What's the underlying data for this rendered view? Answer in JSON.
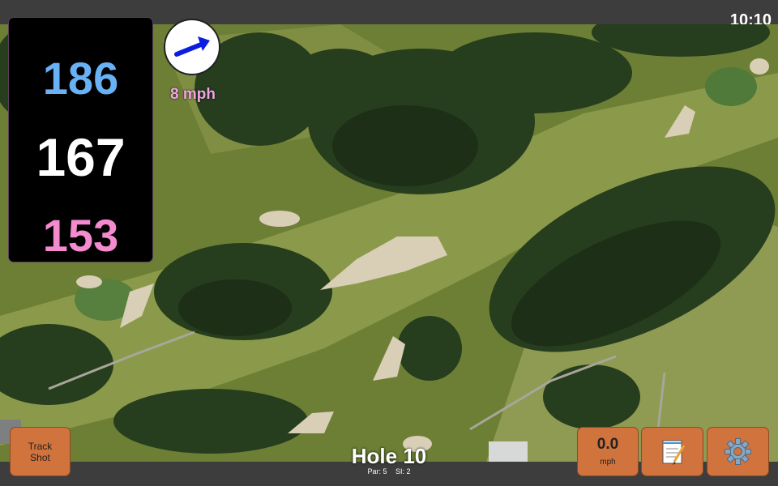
{
  "status_bar": {
    "time": "10:10"
  },
  "distances": {
    "back": "186",
    "middle": "167",
    "front": "153"
  },
  "wind": {
    "speed": "8 mph",
    "direction_icon": "arrow-right-icon",
    "color": "#0a1de0"
  },
  "hole": {
    "title": "Hole 10",
    "par": "Par: 5",
    "si": "SI: 2"
  },
  "buttons": {
    "track_shot": [
      "Track",
      "Shot"
    ],
    "wind_speed_value": "0.0",
    "wind_speed_unit": "mph",
    "notes_icon": "notepad-icon",
    "settings_icon": "gear-icon"
  },
  "colors": {
    "back": "#68b1f5",
    "middle": "#ffffff",
    "front": "#f48bcf",
    "button": "#d1733d",
    "wind_text": "#f2a3e2"
  }
}
